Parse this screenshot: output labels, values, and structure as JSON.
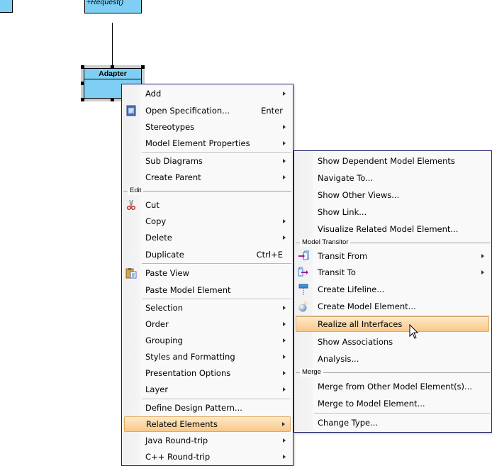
{
  "diagram": {
    "target_class_operation": "+Request()",
    "adapter_class_name": "Adapter"
  },
  "main_menu": {
    "items": [
      {
        "label": "Add",
        "submenu": true
      },
      {
        "label": "Open Specification...",
        "shortcut": "Enter",
        "icon": "specification-icon"
      },
      {
        "label": "Stereotypes",
        "submenu": true
      },
      {
        "label": "Model Element Properties",
        "submenu": true
      },
      {
        "label": "Sub Diagrams",
        "submenu": true
      },
      {
        "label": "Create Parent",
        "submenu": true
      },
      {
        "label": "Cut",
        "icon": "scissors-icon"
      },
      {
        "label": "Copy",
        "submenu": true
      },
      {
        "label": "Delete",
        "submenu": true
      },
      {
        "label": "Duplicate",
        "shortcut": "Ctrl+E"
      },
      {
        "label": "Paste View",
        "icon": "clipboard-icon"
      },
      {
        "label": "Paste Model Element"
      },
      {
        "label": "Selection",
        "submenu": true
      },
      {
        "label": "Order",
        "submenu": true
      },
      {
        "label": "Grouping",
        "submenu": true
      },
      {
        "label": "Styles and Formatting",
        "submenu": true
      },
      {
        "label": "Presentation Options",
        "submenu": true
      },
      {
        "label": "Layer",
        "submenu": true
      },
      {
        "label": "Define Design Pattern..."
      },
      {
        "label": "Related Elements",
        "submenu": true,
        "highlighted": true
      },
      {
        "label": "Java Round-trip",
        "submenu": true
      },
      {
        "label": "C++ Round-trip",
        "submenu": true
      }
    ],
    "groups": {
      "edit": "Edit"
    }
  },
  "sub_menu": {
    "items": [
      {
        "label": "Show Dependent Model Elements"
      },
      {
        "label": "Navigate To..."
      },
      {
        "label": "Show Other Views..."
      },
      {
        "label": "Show Link..."
      },
      {
        "label": "Visualize Related Model Element..."
      },
      {
        "label": "Transit From",
        "submenu": true,
        "icon": "transit-from-icon"
      },
      {
        "label": "Transit To",
        "submenu": true,
        "icon": "transit-to-icon"
      },
      {
        "label": "Create Lifeline...",
        "icon": "lifeline-icon"
      },
      {
        "label": "Create Model Element...",
        "icon": "model-element-icon"
      },
      {
        "label": "Realize all Interfaces",
        "highlighted": true
      },
      {
        "label": "Show Associations"
      },
      {
        "label": "Analysis..."
      },
      {
        "label": "Merge from Other Model Element(s)..."
      },
      {
        "label": "Merge to Model Element..."
      },
      {
        "label": "Change Type..."
      }
    ],
    "groups": {
      "model_transitor": "Model Transitor",
      "merge": "Merge"
    }
  },
  "colors": {
    "class_fill": "#7ecff3",
    "highlight_top": "#fde9c8",
    "highlight_bottom": "#f8c889",
    "menu_border": "#1a1a6e"
  }
}
